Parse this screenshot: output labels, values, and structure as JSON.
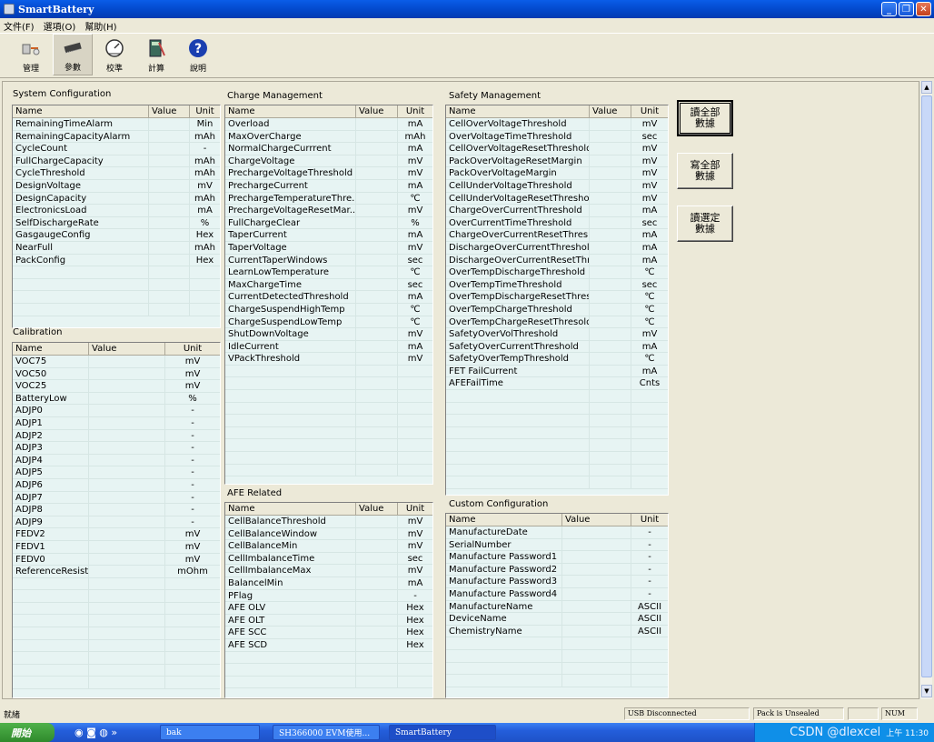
{
  "window": {
    "title": "SmartBattery"
  },
  "menu": [
    "文件(F)",
    "選項(O)",
    "幫助(H)"
  ],
  "toolbar": [
    {
      "label": "管理",
      "icon": "manage-icon"
    },
    {
      "label": "參數",
      "icon": "chip-icon"
    },
    {
      "label": "校準",
      "icon": "calibrate-icon"
    },
    {
      "label": "計算",
      "icon": "calculator-icon"
    },
    {
      "label": "說明",
      "icon": "help-icon"
    }
  ],
  "sysconf": {
    "title": "System Configuration",
    "headers": [
      "Name",
      "Value",
      "Unit"
    ],
    "rows": [
      [
        "RemainingTimeAlarm",
        "",
        "Min"
      ],
      [
        "RemainingCapacityAlarm",
        "",
        "mAh"
      ],
      [
        "CycleCount",
        "",
        "-"
      ],
      [
        "FullChargeCapacity",
        "",
        "mAh"
      ],
      [
        "CycleThreshold",
        "",
        "mAh"
      ],
      [
        "DesignVoltage",
        "",
        "mV"
      ],
      [
        "DesignCapacity",
        "",
        "mAh"
      ],
      [
        "ElectronicsLoad",
        "",
        "mA"
      ],
      [
        "SelfDischargeRate",
        "",
        "%"
      ],
      [
        "GasgaugeConfig",
        "",
        "Hex"
      ],
      [
        "NearFull",
        "",
        "mAh"
      ],
      [
        "PackConfig",
        "",
        "Hex"
      ]
    ]
  },
  "calib": {
    "title": "Calibration",
    "headers": [
      "Name",
      "Value",
      "Unit"
    ],
    "rows": [
      [
        "VOC75",
        "",
        "mV"
      ],
      [
        "VOC50",
        "",
        "mV"
      ],
      [
        "VOC25",
        "",
        "mV"
      ],
      [
        "BatteryLow",
        "",
        "%"
      ],
      [
        "ADJP0",
        "",
        "-"
      ],
      [
        "ADJP1",
        "",
        "-"
      ],
      [
        "ADJP2",
        "",
        "-"
      ],
      [
        "ADJP3",
        "",
        "-"
      ],
      [
        "ADJP4",
        "",
        "-"
      ],
      [
        "ADJP5",
        "",
        "-"
      ],
      [
        "ADJP6",
        "",
        "-"
      ],
      [
        "ADJP7",
        "",
        "-"
      ],
      [
        "ADJP8",
        "",
        "-"
      ],
      [
        "ADJP9",
        "",
        "-"
      ],
      [
        "FEDV2",
        "",
        "mV"
      ],
      [
        "FEDV1",
        "",
        "mV"
      ],
      [
        "FEDV0",
        "",
        "mV"
      ],
      [
        "ReferenceResistor",
        "",
        "mOhm"
      ]
    ]
  },
  "charge": {
    "title": "Charge Management",
    "headers": [
      "Name",
      "Value",
      "Unit"
    ],
    "rows": [
      [
        "Overload",
        "",
        "mA"
      ],
      [
        "MaxOverCharge",
        "",
        "mAh"
      ],
      [
        "NormalChargeCurrrent",
        "",
        "mA"
      ],
      [
        "ChargeVoltage",
        "",
        "mV"
      ],
      [
        "PrechargeVoltageThreshold",
        "",
        "mV"
      ],
      [
        "PrechargeCurrent",
        "",
        "mA"
      ],
      [
        "PrechargeTemperatureThre...",
        "",
        "℃"
      ],
      [
        "PrechargeVoltageResetMar...",
        "",
        "mV"
      ],
      [
        "FullChargeClear",
        "",
        "%"
      ],
      [
        "TaperCurrent",
        "",
        "mA"
      ],
      [
        "TaperVoltage",
        "",
        "mV"
      ],
      [
        "CurrentTaperWindows",
        "",
        "sec"
      ],
      [
        "LearnLowTemperature",
        "",
        "℃"
      ],
      [
        "MaxChargeTime",
        "",
        "sec"
      ],
      [
        "CurrentDetectedThreshold",
        "",
        "mA"
      ],
      [
        "ChargeSuspendHighTemp",
        "",
        "℃"
      ],
      [
        "ChargeSuspendLowTemp",
        "",
        "℃"
      ],
      [
        "ShutDownVoltage",
        "",
        "mV"
      ],
      [
        "IdleCurrent",
        "",
        "mA"
      ],
      [
        "VPackThreshold",
        "",
        "mV"
      ]
    ]
  },
  "afe": {
    "title": "AFE Related",
    "headers": [
      "Name",
      "Value",
      "Unit"
    ],
    "rows": [
      [
        "CellBalanceThreshold",
        "",
        "mV"
      ],
      [
        "CellBalanceWindow",
        "",
        "mV"
      ],
      [
        "CellBalanceMin",
        "",
        "mV"
      ],
      [
        "CellImbalanceTime",
        "",
        "sec"
      ],
      [
        "CellImbalanceMax",
        "",
        "mV"
      ],
      [
        "BalancelMin",
        "",
        "mA"
      ],
      [
        "PFlag",
        "",
        "-"
      ],
      [
        "AFE OLV",
        "",
        "Hex"
      ],
      [
        "AFE OLT",
        "",
        "Hex"
      ],
      [
        "AFE SCC",
        "",
        "Hex"
      ],
      [
        "AFE SCD",
        "",
        "Hex"
      ]
    ]
  },
  "safety": {
    "title": "Safety Management",
    "headers": [
      "Name",
      "Value",
      "Unit"
    ],
    "rows": [
      [
        "CellOverVoltageThreshold",
        "",
        "mV"
      ],
      [
        "OverVoltageTimeThreshold",
        "",
        "sec"
      ],
      [
        "CellOverVoltageResetThreshold",
        "",
        "mV"
      ],
      [
        "PackOverVoltageResetMargin",
        "",
        "mV"
      ],
      [
        "PackOverVoltageMargin",
        "",
        "mV"
      ],
      [
        "CellUnderVoltageThreshold",
        "",
        "mV"
      ],
      [
        "CellUnderVoltageResetThreshold",
        "",
        "mV"
      ],
      [
        "ChargeOverCurrentThreshold",
        "",
        "mA"
      ],
      [
        "OverCurrentTimeThreshold",
        "",
        "sec"
      ],
      [
        "ChargeOverCurrentResetThresh...",
        "",
        "mA"
      ],
      [
        "DischargeOverCurrentThreshold",
        "",
        "mA"
      ],
      [
        "DischargeOverCurrentResetThre",
        "",
        "mA"
      ],
      [
        "OverTempDischargeThreshold",
        "",
        "℃"
      ],
      [
        "OverTempTimeThreshold",
        "",
        "sec"
      ],
      [
        "OverTempDischargeResetThres...",
        "",
        "℃"
      ],
      [
        "OverTempChargeThreshold",
        "",
        "℃"
      ],
      [
        "OverTempChargeResetThresold",
        "",
        "℃"
      ],
      [
        "SafetyOverVolThreshold",
        "",
        "mV"
      ],
      [
        "SafetyOverCurrentThreshold",
        "",
        "mA"
      ],
      [
        "SafetyOverTempThreshold",
        "",
        "℃"
      ],
      [
        "FET FailCurrent",
        "",
        "mA"
      ],
      [
        "AFEFailTime",
        "",
        "Cnts"
      ]
    ]
  },
  "custom": {
    "title": "Custom Configuration",
    "headers": [
      "Name",
      "Value",
      "Unit"
    ],
    "rows": [
      [
        "ManufactureDate",
        "",
        "-"
      ],
      [
        "SerialNumber",
        "",
        "-"
      ],
      [
        "Manufacture Password1",
        "",
        "-"
      ],
      [
        "Manufacture Password2",
        "",
        "-"
      ],
      [
        "Manufacture Password3",
        "",
        "-"
      ],
      [
        "Manufacture Password4",
        "",
        "-"
      ],
      [
        "ManufactureName",
        "",
        "ASCII"
      ],
      [
        "DeviceName",
        "",
        "ASCII"
      ],
      [
        "ChemistryName",
        "",
        "ASCII"
      ]
    ]
  },
  "buttons": {
    "read_all": "讀全部\n數據",
    "write_all": "寫全部\n數據",
    "read_sel": "讀選定\n數據"
  },
  "status": {
    "ready": "就緒",
    "usb": "USB Disconnected",
    "pack": "Pack is Unsealed",
    "num": "NUM"
  },
  "taskbar": {
    "start": "開始",
    "tasks": [
      "bak",
      "SH366000 EVM使用...",
      "SmartBattery"
    ],
    "watermark": "CSDN @dlexcel",
    "clock": "上午 11:30"
  }
}
